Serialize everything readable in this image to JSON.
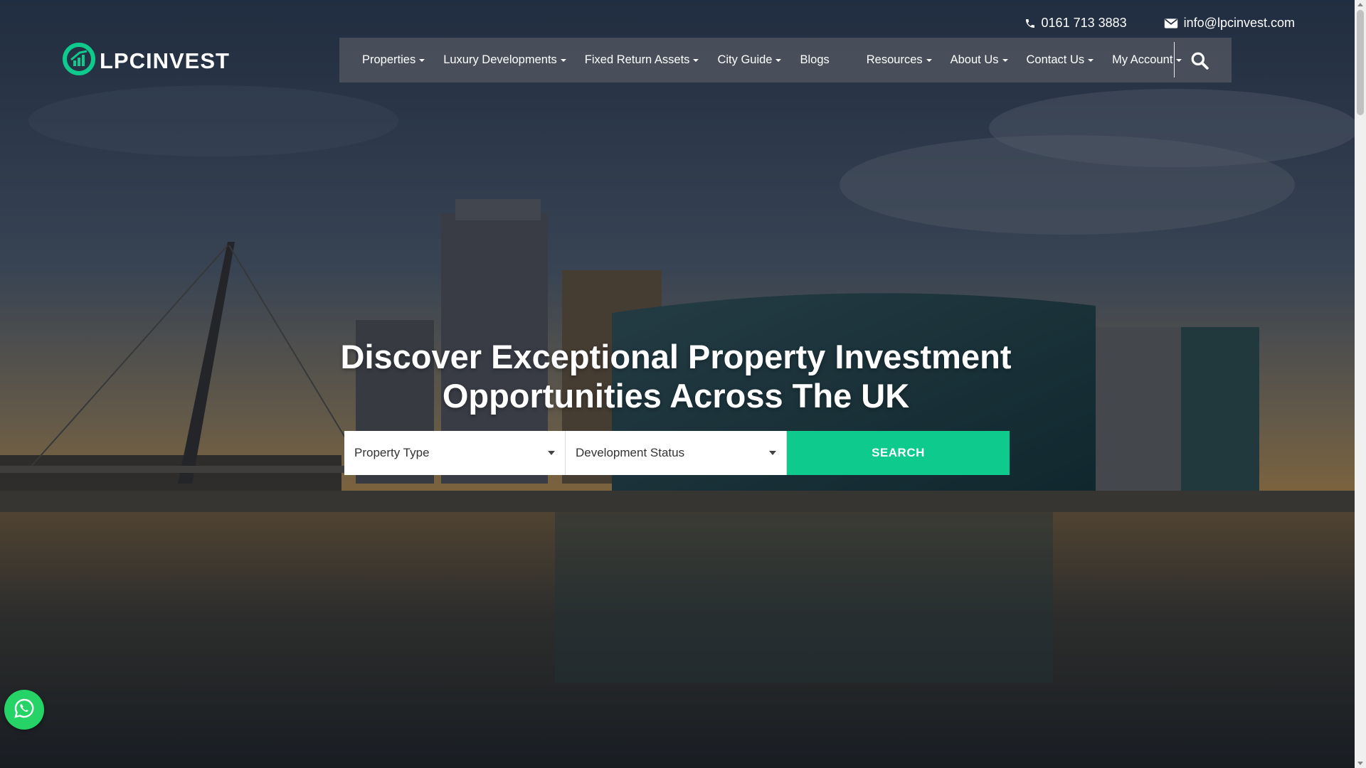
{
  "brand": {
    "name": "LPCINVEST",
    "accent": "#0ecb8d"
  },
  "contact": {
    "phone": "0161 713 3883",
    "phone_icon": "phone-icon",
    "email": "info@lpcinvest.com",
    "email_icon": "envelope-icon"
  },
  "nav": {
    "items": [
      {
        "label": "Properties",
        "dropdown": true
      },
      {
        "label": "Luxury Developments",
        "dropdown": true
      },
      {
        "label": "Fixed Return Assets",
        "dropdown": true
      },
      {
        "label": "City Guide",
        "dropdown": true
      },
      {
        "label": "Blogs",
        "dropdown": false
      },
      {
        "label": "Resources",
        "dropdown": true
      },
      {
        "label": "About Us",
        "dropdown": true
      },
      {
        "label": "Contact Us",
        "dropdown": true
      },
      {
        "label": "My Account",
        "dropdown": true
      }
    ],
    "search_icon": "search-icon"
  },
  "hero": {
    "headline_line1": "Discover Exceptional Property Investment",
    "headline_line2": "Opportunities Across The UK"
  },
  "search": {
    "property_type": "Property Type",
    "development_status": "Development Status",
    "button_label": "SEARCH"
  },
  "floating": {
    "whatsapp_icon": "whatsapp-icon"
  }
}
